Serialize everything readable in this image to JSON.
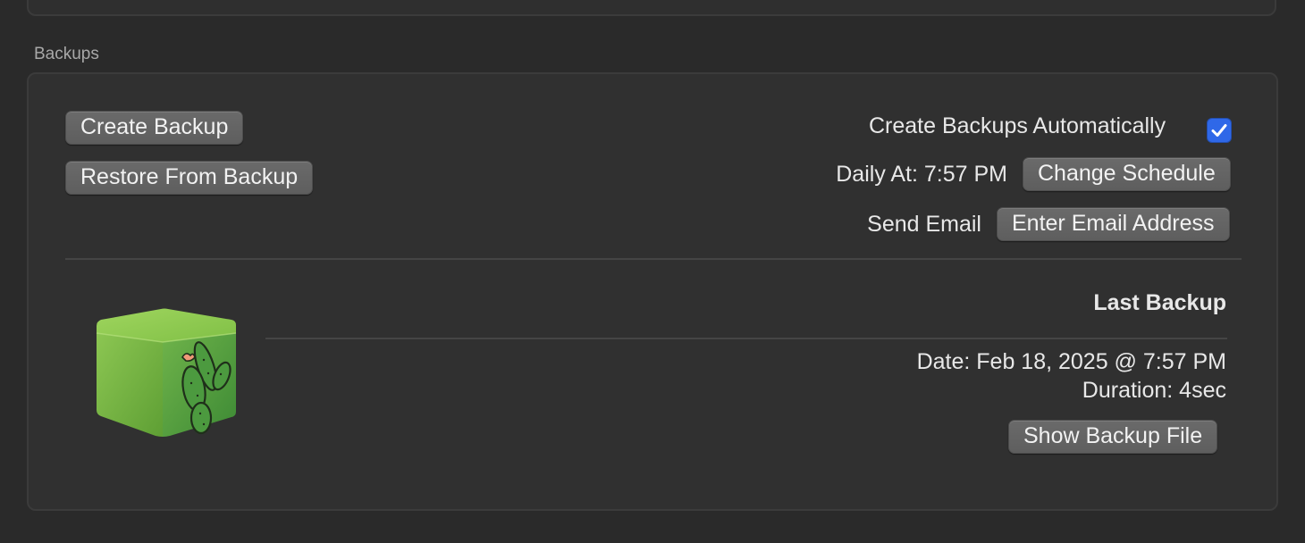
{
  "section": {
    "title": "Backups"
  },
  "buttons": {
    "create_backup": "Create Backup",
    "restore_backup": "Restore From Backup",
    "change_schedule": "Change Schedule",
    "enter_email": "Enter Email Address",
    "show_backup_file": "Show Backup File"
  },
  "auto_backup": {
    "label": "Create Backups Automatically",
    "checked": true
  },
  "schedule": {
    "text": "Daily At: 7:57 PM"
  },
  "email": {
    "label": "Send Email"
  },
  "last_backup": {
    "title": "Last Backup",
    "date": "Date: Feb 18, 2025 @ 7:57 PM",
    "duration": "Duration: 4sec"
  },
  "icons": {
    "backup_cube": "cactus-cube-icon",
    "checkmark": "checkmark-icon"
  },
  "colors": {
    "checkbox_accent": "#2f68e8",
    "panel_bg": "#303030",
    "button_bg": "#626262"
  }
}
